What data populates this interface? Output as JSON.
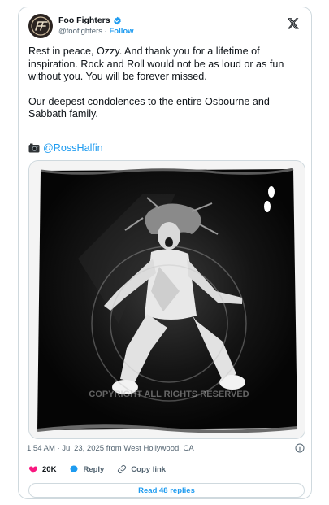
{
  "author": {
    "name": "Foo Fighters",
    "handle": "@foofighters",
    "separator": " · ",
    "follow_label": "Follow",
    "verified": true
  },
  "post": {
    "paragraphs": [
      "Rest in peace, Ozzy. And thank you for a lifetime of inspiration. Rock and Roll would not be as loud or as fun without you. You will be forever missed.",
      "Our deepest condolences to the entire Osbourne and Sabbath family."
    ],
    "credit_mention": "@RossHalfin"
  },
  "image": {
    "alt": "Black and white photo of Ozzy Osbourne leaping in the air on stage",
    "watermark": "COPYRIGHT ALL RIGHTS RESERVED"
  },
  "meta": {
    "timestamp": "1:54 AM · Jul 23, 2025 from West Hollywood, CA"
  },
  "actions": {
    "likes": "20K",
    "reply_label": "Reply",
    "copy_label": "Copy link"
  },
  "read_replies_label": "Read 48 replies",
  "colors": {
    "accent": "#1d9bf0",
    "like": "#f91880",
    "text": "#0f1419",
    "muted": "#536471",
    "border": "#cfd9de"
  }
}
